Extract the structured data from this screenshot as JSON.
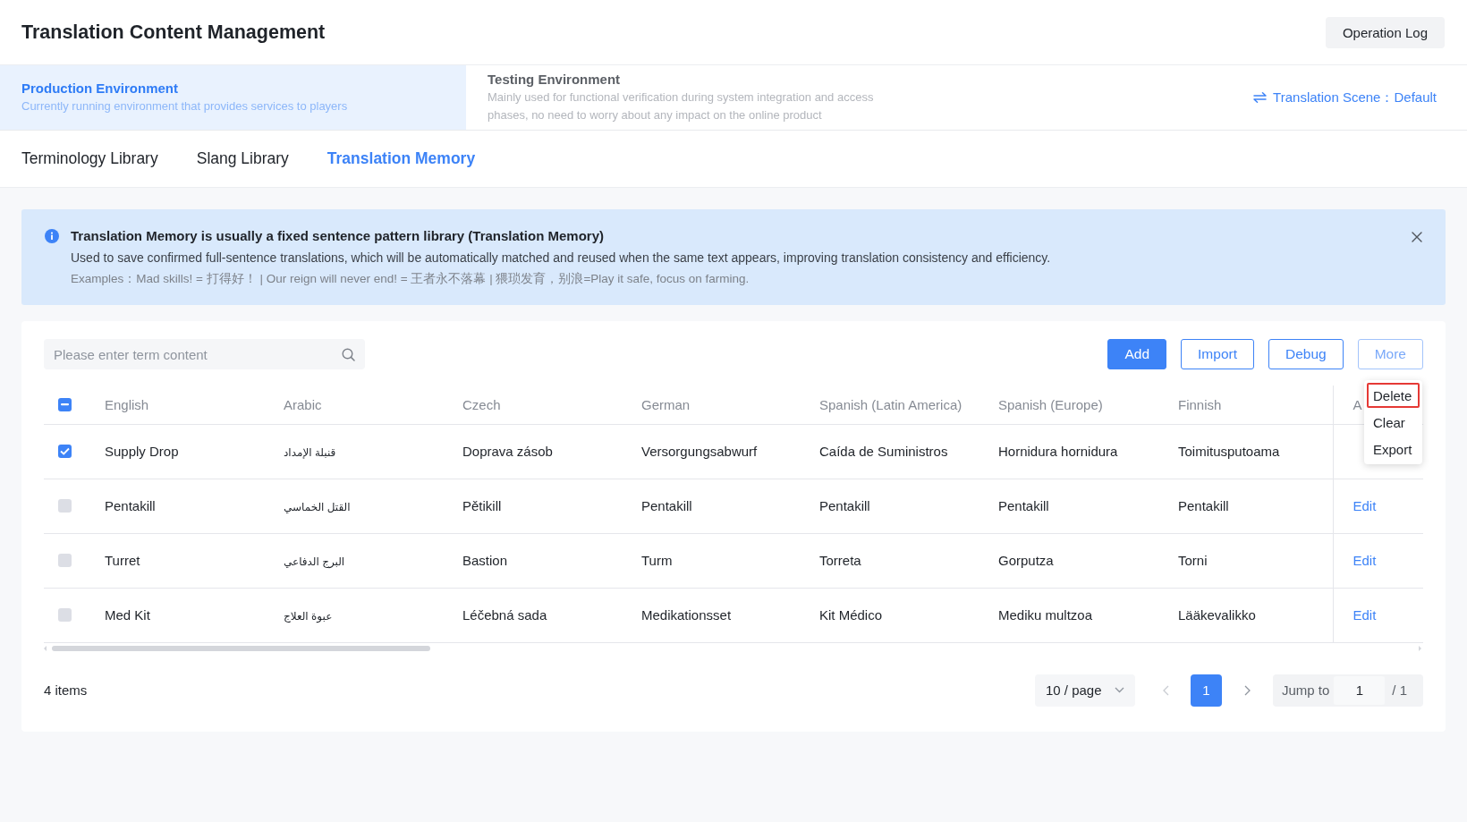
{
  "header": {
    "title": "Translation Content Management",
    "button": "Operation Log"
  },
  "environments": [
    {
      "title": "Production Environment",
      "description": "Currently running environment that provides services to players",
      "selected": true
    },
    {
      "title": "Testing Environment",
      "description": "Mainly used for functional verification during system integration and access phases, no need to worry about any impact on the online product",
      "selected": false
    }
  ],
  "scene": {
    "label": "Translation Scene：",
    "value": "Default"
  },
  "tabs": [
    {
      "label": "Terminology Library",
      "selected": false
    },
    {
      "label": "Slang Library",
      "selected": false
    },
    {
      "label": "Translation Memory",
      "selected": true
    }
  ],
  "alert": {
    "title": "Translation Memory is usually a fixed sentence pattern library (Translation Memory)",
    "description": "Used to save confirmed full-sentence translations, which will be automatically matched and reused when the same text appears, improving translation consistency and efficiency.",
    "examples": "Examples：Mad skills! = 打得好！ | Our reign will never end! = 王者永不落幕 | 猥琐发育，别浪=Play it safe, focus on farming."
  },
  "search": {
    "placeholder": "Please enter term content"
  },
  "buttons": [
    {
      "label": "Add",
      "kind": "primary"
    },
    {
      "label": "Import",
      "kind": "outline"
    },
    {
      "label": "Debug",
      "kind": "outline"
    }
  ],
  "more": {
    "label": "More",
    "open": true,
    "items": [
      {
        "label": "Delete",
        "highlighted": true
      },
      {
        "label": "Clear",
        "highlighted": false
      },
      {
        "label": "Export",
        "highlighted": false
      }
    ]
  },
  "table": {
    "select_all": {
      "indeterminate": true
    },
    "columns": [
      {
        "label": "English",
        "kind": "ltr"
      },
      {
        "label": "Arabic",
        "kind": "rtl"
      },
      {
        "label": "Czech",
        "kind": "ltr"
      },
      {
        "label": "German",
        "kind": "ltr"
      },
      {
        "label": "Spanish (Latin America)",
        "kind": "ltr"
      },
      {
        "label": "Spanish (Europe)",
        "kind": "ltr"
      },
      {
        "label": "Finnish",
        "kind": "ltr"
      }
    ],
    "column_8": "A",
    "rows": [
      {
        "selected": true,
        "cells": [
          "Supply Drop",
          "قنبلة الإمداد",
          "Doprava zásob",
          "Versorgungsabwurf",
          "Caída de Suministros",
          "Hornidura hornidura",
          "Toimitusputoama"
        ]
      },
      {
        "selected": false,
        "cells": [
          "Pentakill",
          "القتل الخماسي",
          "Pětikill",
          "Pentakill",
          "Pentakill",
          "Pentakill",
          "Pentakill"
        ],
        "action": "Edit"
      },
      {
        "selected": false,
        "cells": [
          "Turret",
          "البرج الدفاعي",
          "Bastion",
          "Turm",
          "Torreta",
          "Gorputza",
          "Torni"
        ],
        "action": "Edit"
      },
      {
        "selected": false,
        "cells": [
          "Med Kit",
          "عبوة العلاج",
          "Léčebná sada",
          "Medikationsset",
          "Kit Médico",
          "Mediku multzoa",
          "Lääkevalikko"
        ],
        "action": "Edit"
      }
    ]
  },
  "footer": {
    "total": "4 items",
    "page_size": "10 / page",
    "prev": {
      "disabled": true
    },
    "pages": [
      {
        "label": "1",
        "selected": true
      }
    ],
    "next": {
      "disabled": false
    },
    "jump": {
      "label": "Jump to",
      "value": "1",
      "total": "/ 1"
    }
  }
}
